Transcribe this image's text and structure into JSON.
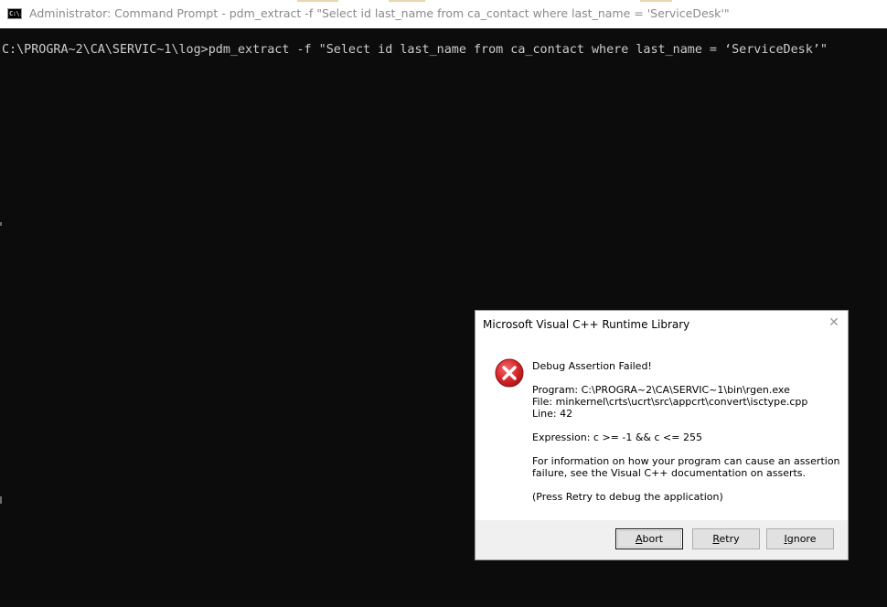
{
  "window": {
    "title": "Administrator: Command Prompt - pdm_extract  -f \"Select id last_name from ca_contact where last_name = 'ServiceDesk'\"",
    "icon_text": "C:\\."
  },
  "console": {
    "line1": "C:\\PROGRA~2\\CA\\SERVIC~1\\log>pdm_extract -f \"Select id last_name from ca_contact where last_name = ‘ServiceDesk’\""
  },
  "dialog": {
    "title": "Microsoft Visual C++ Runtime Library",
    "close_icon": "close-icon",
    "error_icon": "error-icon",
    "heading": "Debug Assertion Failed!",
    "program": "Program: C:\\PROGRA~2\\CA\\SERVIC~1\\bin\\rgen.exe",
    "file": "File: minkernel\\crts\\ucrt\\src\\appcrt\\convert\\isctype.cpp",
    "line": "Line: 42",
    "expression": "Expression: c >= -1 && c <= 255",
    "info1": "For information on how your program can cause an assertion",
    "info2": "failure, see the Visual C++ documentation on asserts.",
    "hint": "(Press Retry to debug the application)",
    "buttons": {
      "abort": {
        "mnemonic": "A",
        "rest": "bort"
      },
      "retry": {
        "mnemonic": "R",
        "rest": "etry"
      },
      "ignore": {
        "mnemonic": "I",
        "rest": "gnore"
      }
    },
    "colors": {
      "error_red": "#d7262b",
      "footer": "#f0f0f0"
    }
  }
}
